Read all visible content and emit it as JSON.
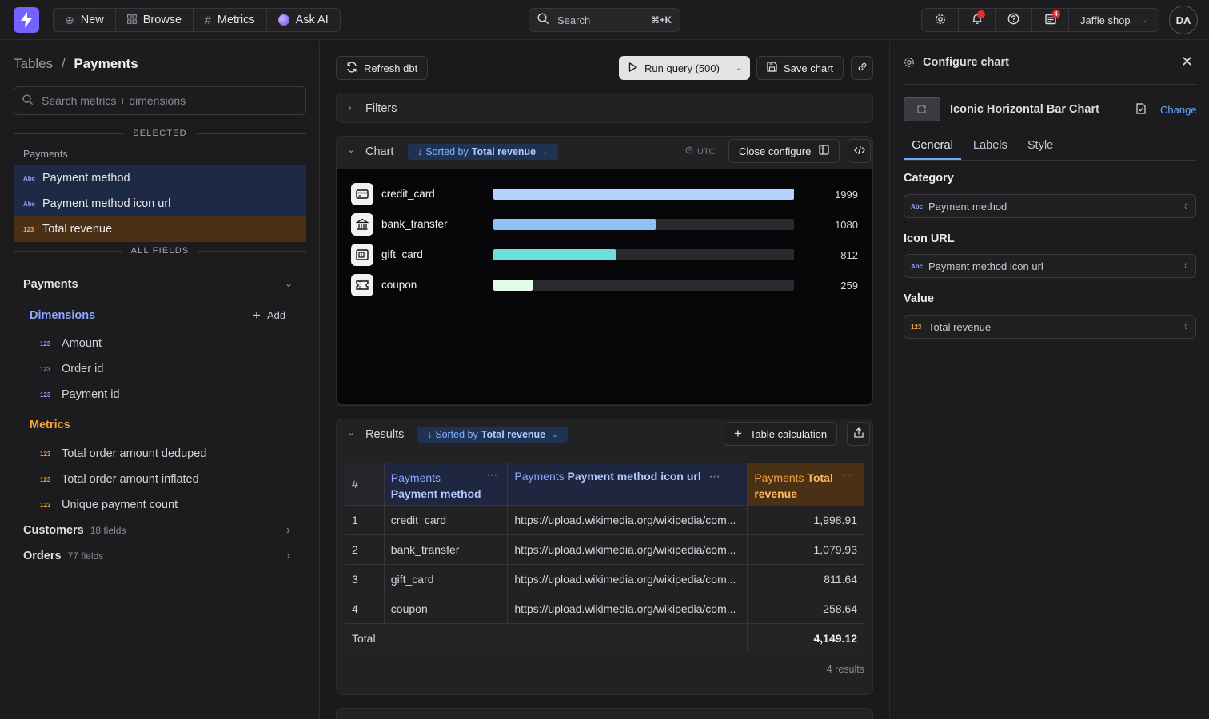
{
  "topnav": {
    "new_label": "New",
    "browse_label": "Browse",
    "metrics_label": "Metrics",
    "ask_ai_label": "Ask AI",
    "search_label": "Search",
    "search_shortcut": "⌘+K",
    "notifications_badge": "4",
    "project_label": "Jaffle shop",
    "avatar_initials": "DA"
  },
  "sidebar": {
    "breadcrumb_root": "Tables",
    "breadcrumb_sep": "/",
    "breadcrumb_current": "Payments",
    "search_placeholder": "Search metrics + dimensions",
    "selected_label": "SELECTED",
    "selected_table": "Payments",
    "selected": [
      {
        "type": "Abc",
        "label": "Payment method"
      },
      {
        "type": "Abc",
        "label": "Payment method icon url"
      },
      {
        "type": "123",
        "label": "Total revenue"
      }
    ],
    "all_fields_label": "ALL FIELDS",
    "payments_label": "Payments",
    "dimensions_label": "Dimensions",
    "add_label": "Add",
    "dimensions": [
      {
        "type": "123",
        "label": "Amount"
      },
      {
        "type": "123",
        "label": "Order id"
      },
      {
        "type": "123",
        "label": "Payment id"
      }
    ],
    "metrics_label": "Metrics",
    "metrics": [
      {
        "type": "123",
        "label": "Total order amount deduped"
      },
      {
        "type": "123",
        "label": "Total order amount inflated"
      },
      {
        "type": "123",
        "label": "Unique payment count"
      }
    ],
    "customers_label": "Customers",
    "customers_count": "18 fields",
    "orders_label": "Orders",
    "orders_count": "77 fields"
  },
  "toolbar": {
    "refresh_label": "Refresh dbt",
    "run_label": "Run query (500)",
    "save_label": "Save chart"
  },
  "filters_label": "Filters",
  "chart_panel": {
    "title": "Chart",
    "sort_prefix": "Sorted by",
    "sort_field": "Total revenue",
    "tz_label": "UTC",
    "close_configure_label": "Close configure"
  },
  "chart_data": {
    "type": "bar",
    "orientation": "horizontal",
    "categories": [
      "credit_card",
      "bank_transfer",
      "gift_card",
      "coupon"
    ],
    "values": [
      1999,
      1080,
      812,
      259
    ],
    "xlim": [
      0,
      1999
    ],
    "colors": [
      "#b4d3fe",
      "#8ec2f5",
      "#6edfd8",
      "#e5fbea"
    ],
    "icons": [
      "credit-card-icon",
      "bank-icon",
      "gift-card-icon",
      "coupon-icon"
    ]
  },
  "results": {
    "title": "Results",
    "sort_prefix": "Sorted by",
    "sort_field": "Total revenue",
    "table_calc_label": "Table calculation",
    "columns": [
      {
        "table": "#",
        "field": ""
      },
      {
        "table": "Payments",
        "field": "Payment method"
      },
      {
        "table": "Payments",
        "field": "Payment method icon url"
      },
      {
        "table": "Payments",
        "field": "Total revenue"
      }
    ],
    "rows": [
      [
        "1",
        "credit_card",
        "https://upload.wikimedia.org/wikipedia/com...",
        "1,998.91"
      ],
      [
        "2",
        "bank_transfer",
        "https://upload.wikimedia.org/wikipedia/com...",
        "1,079.93"
      ],
      [
        "3",
        "gift_card",
        "https://upload.wikimedia.org/wikipedia/com...",
        "811.64"
      ],
      [
        "4",
        "coupon",
        "https://upload.wikimedia.org/wikipedia/com...",
        "258.64"
      ]
    ],
    "total_label": "Total",
    "total_value": "4,149.12",
    "count_label": "4 results"
  },
  "config": {
    "title": "Configure chart",
    "chart_type": "Iconic Horizontal Bar Chart",
    "change_label": "Change",
    "tabs": [
      "General",
      "Labels",
      "Style"
    ],
    "active_tab": "General",
    "category_label": "Category",
    "category_type": "Abc",
    "category_value": "Payment method",
    "icon_url_label": "Icon URL",
    "icon_url_type": "Abc",
    "icon_url_value": "Payment method icon url",
    "value_label": "Value",
    "value_type": "123",
    "value_value": "Total revenue"
  }
}
